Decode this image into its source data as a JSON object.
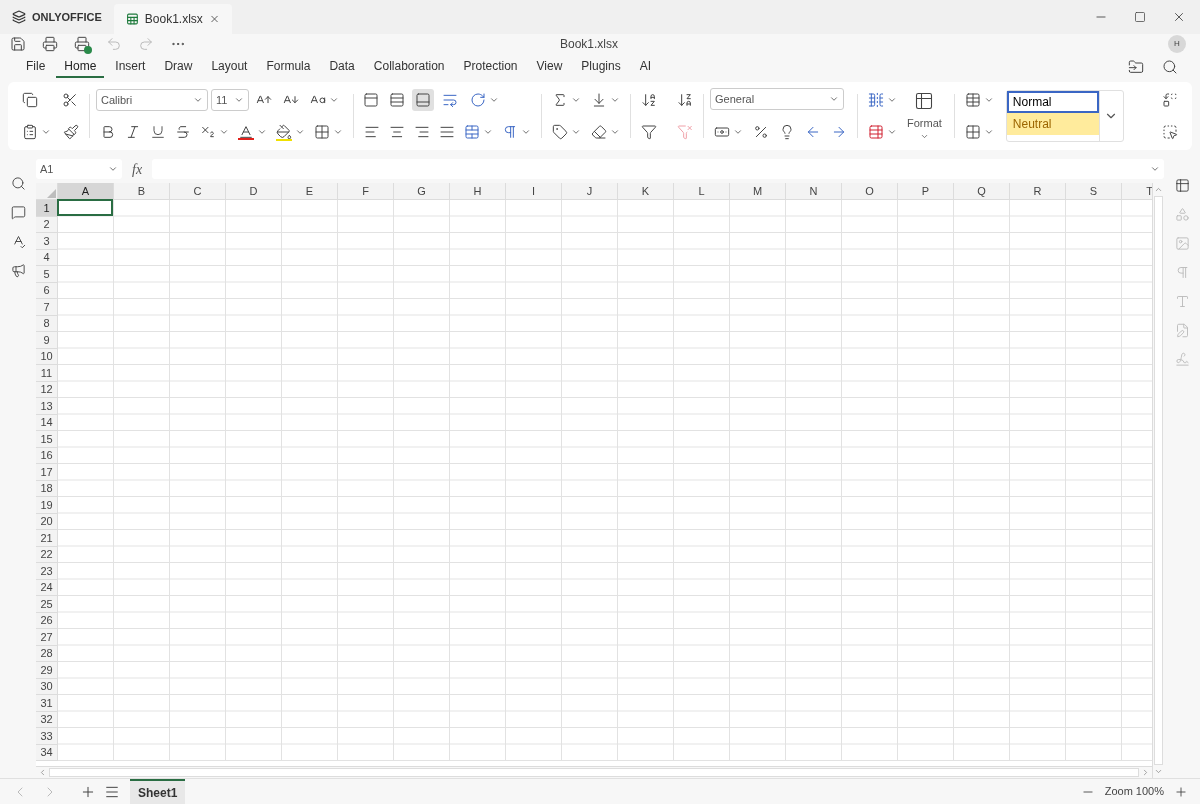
{
  "app_tabs": [
    {
      "kind": "brand",
      "label": "ONLYOFFICE",
      "selected": false
    },
    {
      "kind": "file",
      "label": "Book1.xlsx",
      "selected": true
    }
  ],
  "title": "Book1.xlsx",
  "avatar": "H",
  "menu": [
    {
      "label": "File",
      "selected": false
    },
    {
      "label": "Home",
      "selected": true
    },
    {
      "label": "Insert",
      "selected": false
    },
    {
      "label": "Draw",
      "selected": false
    },
    {
      "label": "Layout",
      "selected": false
    },
    {
      "label": "Formula",
      "selected": false
    },
    {
      "label": "Data",
      "selected": false
    },
    {
      "label": "Collaboration",
      "selected": false
    },
    {
      "label": "Protection",
      "selected": false
    },
    {
      "label": "View",
      "selected": false
    },
    {
      "label": "Plugins",
      "selected": false
    },
    {
      "label": "AI",
      "selected": false
    }
  ],
  "toolbar": {
    "font": "Calibri",
    "font_size": "11",
    "number_format": "General",
    "format_label": "Format",
    "vertical_align": [
      {
        "kind": "top",
        "selected": false
      },
      {
        "kind": "middle",
        "selected": false
      },
      {
        "kind": "bottom",
        "selected": true
      }
    ],
    "clear_filter_disabled": true,
    "styles": [
      {
        "label": "Normal",
        "selected": true,
        "color": "#ffffff"
      },
      {
        "label": "Neutral",
        "selected": false,
        "color": "#ffeb9c"
      }
    ]
  },
  "name_box": "A1",
  "fx_label": "fx",
  "columns": [
    {
      "label": "A",
      "selected": true
    },
    {
      "label": "B",
      "selected": false
    },
    {
      "label": "C",
      "selected": false
    },
    {
      "label": "D",
      "selected": false
    },
    {
      "label": "E",
      "selected": false
    },
    {
      "label": "F",
      "selected": false
    },
    {
      "label": "G",
      "selected": false
    },
    {
      "label": "H",
      "selected": false
    },
    {
      "label": "I",
      "selected": false
    },
    {
      "label": "J",
      "selected": false
    },
    {
      "label": "K",
      "selected": false
    },
    {
      "label": "L",
      "selected": false
    },
    {
      "label": "M",
      "selected": false
    },
    {
      "label": "N",
      "selected": false
    },
    {
      "label": "O",
      "selected": false
    },
    {
      "label": "P",
      "selected": false
    },
    {
      "label": "Q",
      "selected": false
    },
    {
      "label": "R",
      "selected": false
    },
    {
      "label": "S",
      "selected": false
    },
    {
      "label": "T",
      "selected": false
    }
  ],
  "rows": [
    {
      "label": "1",
      "selected": true
    },
    {
      "label": "2",
      "selected": false
    },
    {
      "label": "3",
      "selected": false
    },
    {
      "label": "4",
      "selected": false
    },
    {
      "label": "5",
      "selected": false
    },
    {
      "label": "6",
      "selected": false
    },
    {
      "label": "7",
      "selected": false
    },
    {
      "label": "8",
      "selected": false
    },
    {
      "label": "9",
      "selected": false
    },
    {
      "label": "10",
      "selected": false
    },
    {
      "label": "11",
      "selected": false
    },
    {
      "label": "12",
      "selected": false
    },
    {
      "label": "13",
      "selected": false
    },
    {
      "label": "14",
      "selected": false
    },
    {
      "label": "15",
      "selected": false
    },
    {
      "label": "16",
      "selected": false
    },
    {
      "label": "17",
      "selected": false
    },
    {
      "label": "18",
      "selected": false
    },
    {
      "label": "19",
      "selected": false
    },
    {
      "label": "20",
      "selected": false
    },
    {
      "label": "21",
      "selected": false
    },
    {
      "label": "22",
      "selected": false
    },
    {
      "label": "23",
      "selected": false
    },
    {
      "label": "24",
      "selected": false
    },
    {
      "label": "25",
      "selected": false
    },
    {
      "label": "26",
      "selected": false
    },
    {
      "label": "27",
      "selected": false
    },
    {
      "label": "28",
      "selected": false
    },
    {
      "label": "29",
      "selected": false
    },
    {
      "label": "30",
      "selected": false
    },
    {
      "label": "31",
      "selected": false
    },
    {
      "label": "32",
      "selected": false
    },
    {
      "label": "33",
      "selected": false
    },
    {
      "label": "34",
      "selected": false
    }
  ],
  "sheets": [
    {
      "label": "Sheet1",
      "selected": true
    }
  ],
  "zoom": "Zoom 100%"
}
